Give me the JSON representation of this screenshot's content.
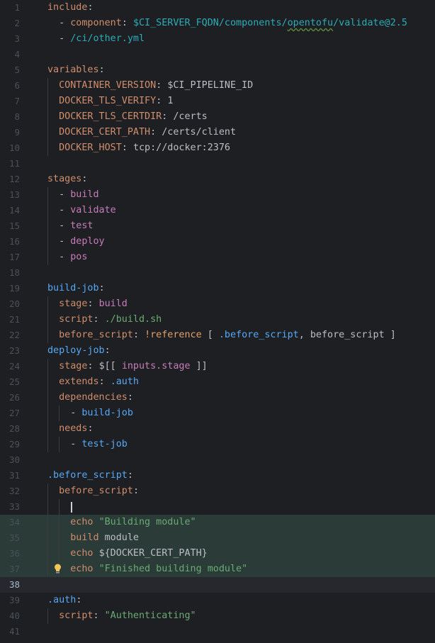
{
  "editor": {
    "current_line": 38,
    "lines": [
      {
        "n": "1",
        "tokens": [
          {
            "c": "t-key",
            "t": "include"
          },
          {
            "c": "t-punc",
            "t": ":"
          }
        ]
      },
      {
        "n": "2",
        "tokens": [
          {
            "c": "t-punc",
            "t": "  - "
          },
          {
            "c": "t-key",
            "t": "component"
          },
          {
            "c": "t-punc",
            "t": ": "
          },
          {
            "c": "t-teal",
            "t": "$CI_SERVER_FQDN/components/"
          },
          {
            "c": "t-teal squiggle",
            "t": "opentofu"
          },
          {
            "c": "t-teal",
            "t": "/validate@2.5"
          }
        ]
      },
      {
        "n": "3",
        "tokens": [
          {
            "c": "t-punc",
            "t": "  - "
          },
          {
            "c": "t-teal",
            "t": "/ci/other.yml"
          }
        ]
      },
      {
        "n": "4",
        "tokens": []
      },
      {
        "n": "5",
        "tokens": [
          {
            "c": "t-key",
            "t": "variables"
          },
          {
            "c": "t-punc",
            "t": ":"
          }
        ]
      },
      {
        "n": "6",
        "tokens": [
          {
            "c": "t-key",
            "t": "  CONTAINER_VERSION"
          },
          {
            "c": "t-punc",
            "t": ": "
          },
          {
            "c": "t-plain",
            "t": "$CI_PIPELINE_ID"
          }
        ]
      },
      {
        "n": "7",
        "tokens": [
          {
            "c": "t-key",
            "t": "  DOCKER_TLS_VERIFY"
          },
          {
            "c": "t-punc",
            "t": ": "
          },
          {
            "c": "t-plain",
            "t": "1"
          }
        ]
      },
      {
        "n": "8",
        "tokens": [
          {
            "c": "t-key",
            "t": "  DOCKER_TLS_CERTDIR"
          },
          {
            "c": "t-punc",
            "t": ": "
          },
          {
            "c": "t-plain",
            "t": "/certs"
          }
        ]
      },
      {
        "n": "9",
        "tokens": [
          {
            "c": "t-key",
            "t": "  DOCKER_CERT_PATH"
          },
          {
            "c": "t-punc",
            "t": ": "
          },
          {
            "c": "t-plain",
            "t": "/certs/client"
          }
        ]
      },
      {
        "n": "10",
        "tokens": [
          {
            "c": "t-key",
            "t": "  DOCKER_HOST"
          },
          {
            "c": "t-punc",
            "t": ": "
          },
          {
            "c": "t-plain",
            "t": "tcp://docker:2376"
          }
        ]
      },
      {
        "n": "11",
        "tokens": []
      },
      {
        "n": "12",
        "tokens": [
          {
            "c": "t-key",
            "t": "stages"
          },
          {
            "c": "t-punc",
            "t": ":"
          }
        ]
      },
      {
        "n": "13",
        "tokens": [
          {
            "c": "t-punc",
            "t": "  - "
          },
          {
            "c": "t-pink",
            "t": "build"
          }
        ]
      },
      {
        "n": "14",
        "tokens": [
          {
            "c": "t-punc",
            "t": "  - "
          },
          {
            "c": "t-pink",
            "t": "validate"
          }
        ]
      },
      {
        "n": "15",
        "tokens": [
          {
            "c": "t-punc",
            "t": "  - "
          },
          {
            "c": "t-pink",
            "t": "test"
          }
        ]
      },
      {
        "n": "16",
        "tokens": [
          {
            "c": "t-punc",
            "t": "  - "
          },
          {
            "c": "t-pink",
            "t": "deploy"
          }
        ]
      },
      {
        "n": "17",
        "tokens": [
          {
            "c": "t-punc",
            "t": "  - "
          },
          {
            "c": "t-pink",
            "t": "pos"
          }
        ]
      },
      {
        "n": "18",
        "tokens": []
      },
      {
        "n": "19",
        "tokens": [
          {
            "c": "t-blue",
            "t": "build-job"
          },
          {
            "c": "t-punc",
            "t": ":"
          }
        ]
      },
      {
        "n": "20",
        "tokens": [
          {
            "c": "t-key",
            "t": "  stage"
          },
          {
            "c": "t-punc",
            "t": ": "
          },
          {
            "c": "t-pink",
            "t": "build"
          }
        ]
      },
      {
        "n": "21",
        "tokens": [
          {
            "c": "t-key",
            "t": "  script"
          },
          {
            "c": "t-punc",
            "t": ": "
          },
          {
            "c": "t-val",
            "t": "./build.sh"
          }
        ]
      },
      {
        "n": "22",
        "tokens": [
          {
            "c": "t-key",
            "t": "  before_script"
          },
          {
            "c": "t-punc",
            "t": ": "
          },
          {
            "c": "t-key2",
            "t": "!reference"
          },
          {
            "c": "t-punc",
            "t": " [ "
          },
          {
            "c": "t-blue",
            "t": ".before_script"
          },
          {
            "c": "t-punc",
            "t": ", "
          },
          {
            "c": "t-plain",
            "t": "before_script"
          },
          {
            "c": "t-punc",
            "t": " ]"
          }
        ]
      },
      {
        "n": "23",
        "tokens": [
          {
            "c": "t-blue",
            "t": "deploy-job"
          },
          {
            "c": "t-punc",
            "t": ":"
          }
        ]
      },
      {
        "n": "24",
        "tokens": [
          {
            "c": "t-key",
            "t": "  stage"
          },
          {
            "c": "t-punc",
            "t": ": "
          },
          {
            "c": "t-plain",
            "t": "$[[ "
          },
          {
            "c": "t-pink",
            "t": "inputs.stage"
          },
          {
            "c": "t-plain",
            "t": " ]]"
          }
        ]
      },
      {
        "n": "25",
        "tokens": [
          {
            "c": "t-key",
            "t": "  extends"
          },
          {
            "c": "t-punc",
            "t": ": "
          },
          {
            "c": "t-blue",
            "t": ".auth"
          }
        ]
      },
      {
        "n": "26",
        "tokens": [
          {
            "c": "t-key",
            "t": "  dependencies"
          },
          {
            "c": "t-punc",
            "t": ":"
          }
        ]
      },
      {
        "n": "27",
        "tokens": [
          {
            "c": "t-punc",
            "t": "    - "
          },
          {
            "c": "t-blue",
            "t": "build-job"
          }
        ]
      },
      {
        "n": "28",
        "tokens": [
          {
            "c": "t-key",
            "t": "  needs"
          },
          {
            "c": "t-punc",
            "t": ":"
          }
        ]
      },
      {
        "n": "29",
        "tokens": [
          {
            "c": "t-punc",
            "t": "    - "
          },
          {
            "c": "t-blue",
            "t": "test-job"
          }
        ]
      },
      {
        "n": "30",
        "tokens": []
      },
      {
        "n": "31",
        "tokens": [
          {
            "c": "t-blue",
            "t": ".before_script"
          },
          {
            "c": "t-punc",
            "t": ":"
          }
        ]
      },
      {
        "n": "32",
        "tokens": [
          {
            "c": "t-key",
            "t": "  before_script"
          },
          {
            "c": "t-punc",
            "t": ":"
          }
        ]
      },
      {
        "n": "33",
        "tokens": []
      },
      {
        "n": "34",
        "tokens": [
          {
            "c": "t-key",
            "t": "    echo "
          },
          {
            "c": "t-val",
            "t": "\"Building module\""
          }
        ]
      },
      {
        "n": "35",
        "tokens": [
          {
            "c": "t-key",
            "t": "    build "
          },
          {
            "c": "t-plain",
            "t": "module"
          }
        ]
      },
      {
        "n": "36",
        "tokens": [
          {
            "c": "t-key",
            "t": "    echo "
          },
          {
            "c": "t-plain",
            "t": "${DOCKER_CERT_PATH}"
          }
        ]
      },
      {
        "n": "37",
        "tokens": [
          {
            "c": "t-key",
            "t": "    echo "
          },
          {
            "c": "t-val",
            "t": "\"Finished building module\""
          }
        ]
      },
      {
        "n": "38",
        "tokens": []
      },
      {
        "n": "39",
        "tokens": [
          {
            "c": "t-blue",
            "t": ".auth"
          },
          {
            "c": "t-punc",
            "t": ":"
          }
        ]
      },
      {
        "n": "40",
        "tokens": [
          {
            "c": "t-key",
            "t": "  script"
          },
          {
            "c": "t-punc",
            "t": ": "
          },
          {
            "c": "t-val",
            "t": "\"Authenticating\""
          }
        ]
      },
      {
        "n": "41",
        "tokens": []
      }
    ]
  },
  "icons": {
    "intention_bulb": "lightbulb-icon"
  },
  "colors": {
    "background": "#1e1f22",
    "key": "#cf8e6d",
    "string": "#6aab73",
    "anchor": "#56a8f5",
    "path": "#2aacb8",
    "enum": "#c77dbb",
    "highlight": "#2a3b38"
  }
}
